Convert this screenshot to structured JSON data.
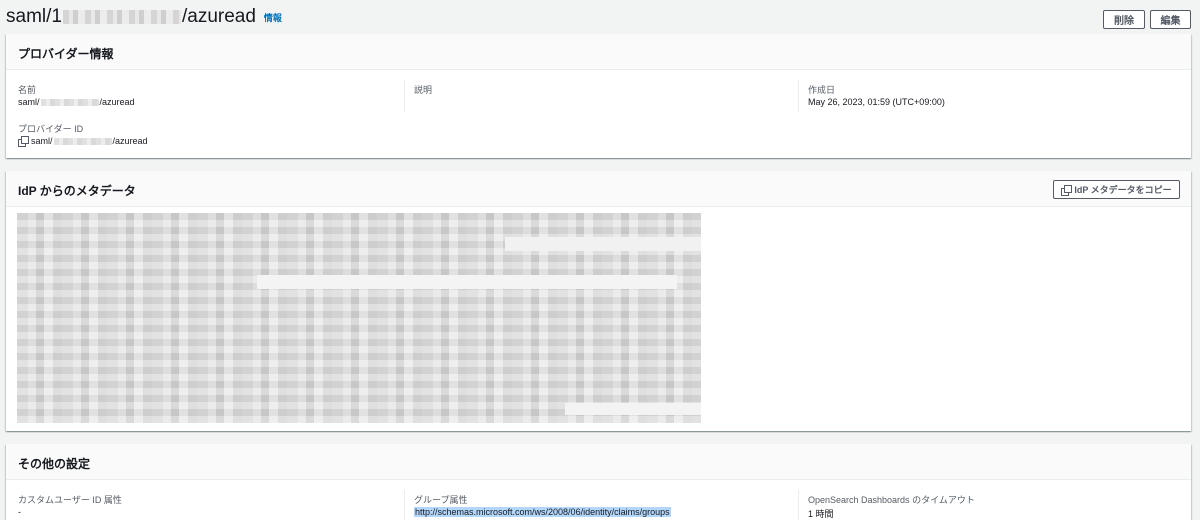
{
  "header": {
    "title_prefix": "saml/1",
    "title_suffix": "/azuread",
    "info_link": "情報",
    "delete_button": "削除",
    "edit_button": "編集"
  },
  "provider_info": {
    "title": "プロバイダー情報",
    "name_label": "名前",
    "name_prefix": "saml/",
    "name_suffix": "/azuread",
    "description_label": "説明",
    "created_label": "作成日",
    "created_value": "May 26, 2023, 01:59 (UTC+09:00)",
    "provider_id_label": "プロバイダー ID",
    "provider_id_prefix": "saml/",
    "provider_id_suffix": "/azuread"
  },
  "idp_metadata": {
    "title": "IdP からのメタデータ",
    "copy_button": "IdP メタデータをコピー"
  },
  "other_settings": {
    "title": "その他の設定",
    "custom_user_id_label": "カスタムユーザー ID 属性",
    "custom_user_id_value": "-",
    "group_attr_label": "グループ属性",
    "group_attr_value": "http://schemas.microsoft.com/ws/2008/06/identity/claims/groups",
    "timeout_label": "OpenSearch Dashboards のタイムアウト",
    "timeout_value": "1 時間"
  }
}
